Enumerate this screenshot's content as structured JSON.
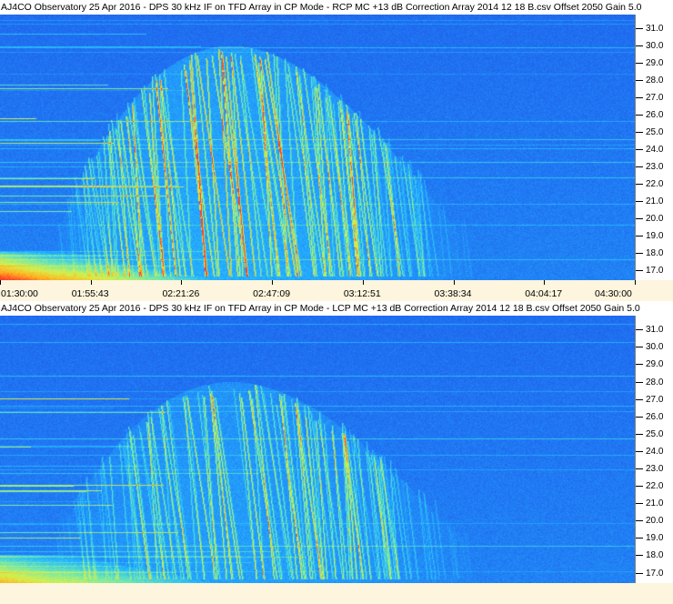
{
  "chart_data": [
    {
      "type": "heatmap",
      "title": "AJ4CO Observatory 25 Apr 2016 - DPS 30 kHz IF on TFD Array in CP Mode - RCP  MC +13 dB  Correction Array 2014 12 18 B.csv  Offset 2050  Gain 5.0",
      "x_tick_labels": [
        "01:30:00",
        "01:55:43",
        "02:21:26",
        "02:47:09",
        "03:12:51",
        "03:38:34",
        "04:04:17",
        "04:30:00"
      ],
      "y_tick_labels": [
        "31.0",
        "30.0",
        "29.0",
        "28.0",
        "27.0",
        "26.0",
        "25.0",
        "24.0",
        "23.0",
        "22.0",
        "21.0",
        "20.0",
        "19.0",
        "18.0",
        "17.0"
      ],
      "y_axis_side": "right",
      "xlim": [
        "01:30:00",
        "04:30:00"
      ],
      "ylim": [
        16.4,
        31.8
      ],
      "colormap": [
        "#1e3fd6",
        "#1f6cf0",
        "#25b8ff",
        "#6fe8b0",
        "#d6f04a",
        "#ffb020",
        "#ff3a2a"
      ],
      "emission_features": {
        "burst_window_start": "01:45:00",
        "burst_window_end": "03:45:00",
        "low_freq_band_edge": 18.0,
        "high_freq_edge_at_peak": 30.0
      }
    },
    {
      "type": "heatmap",
      "title": "AJ4CO Observatory 25 Apr 2016 - DPS 30 kHz IF on TFD Array in CP Mode - LCP  MC +13 dB  Correction Array 2014 12 18 B.csv  Offset 2050  Gain 5.0",
      "x_tick_labels": [],
      "y_tick_labels": [
        "31.0",
        "30.0",
        "29.0",
        "28.0",
        "27.0",
        "26.0",
        "25.0",
        "24.0",
        "23.0",
        "22.0",
        "21.0",
        "20.0",
        "19.0",
        "18.0",
        "17.0"
      ],
      "y_axis_side": "right",
      "xlim": [
        "01:30:00",
        "04:30:00"
      ],
      "ylim": [
        16.4,
        31.8
      ],
      "colormap": [
        "#1e3fd6",
        "#1f6cf0",
        "#25b8ff",
        "#6fe8b0",
        "#d6f04a",
        "#ffb020",
        "#ff3a2a"
      ],
      "emission_features": {
        "burst_window_start": "01:45:00",
        "burst_window_end": "03:45:00",
        "low_freq_band_edge": 18.0,
        "high_freq_edge_at_peak": 28.0
      }
    }
  ]
}
